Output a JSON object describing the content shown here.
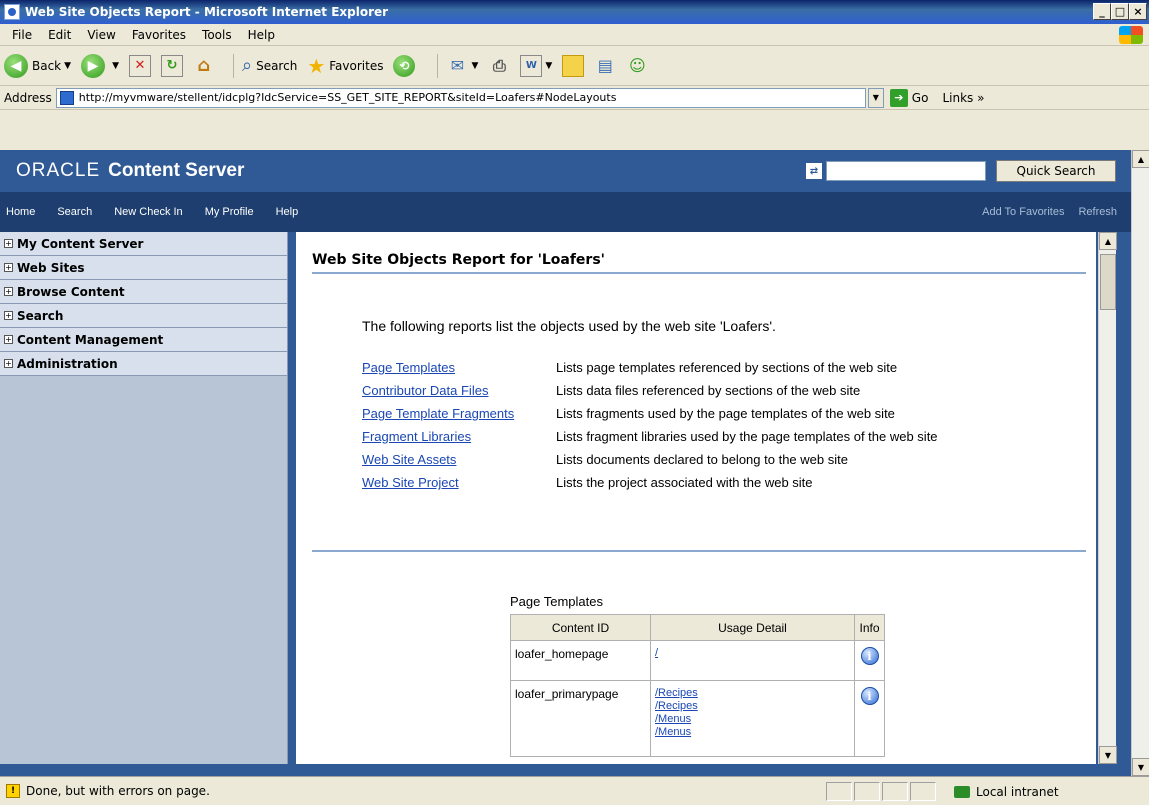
{
  "window": {
    "title": "Web Site Objects Report - Microsoft Internet Explorer"
  },
  "menu": [
    "File",
    "Edit",
    "View",
    "Favorites",
    "Tools",
    "Help"
  ],
  "toolbar": {
    "back_label": "Back",
    "search_label": "Search",
    "favorites_label": "Favorites"
  },
  "address": {
    "label": "Address",
    "url": "http://myvmware/stellent/idcplg?IdcService=SS_GET_SITE_REPORT&siteId=Loafers#NodeLayouts",
    "go_label": "Go",
    "links_label": "Links"
  },
  "header": {
    "brand_oracle": "ORACLE",
    "brand_product": "Content Server",
    "quick_search_label": "Quick Search"
  },
  "nav": {
    "items": [
      "Home",
      "Search",
      "New Check In",
      "My Profile",
      "Help"
    ],
    "right_items": [
      "Add To Favorites",
      "Refresh"
    ]
  },
  "sidebar": {
    "items": [
      "My Content Server",
      "Web Sites",
      "Browse Content",
      "Search",
      "Content Management",
      "Administration"
    ]
  },
  "main": {
    "title": "Web Site Objects Report for 'Loafers'",
    "intro": "The following reports list the objects used by the web site 'Loafers'.",
    "reports": [
      {
        "link": "Page Templates",
        "desc": "Lists page templates referenced by sections of the web site"
      },
      {
        "link": "Contributor Data Files",
        "desc": "Lists data files referenced by sections of the web site"
      },
      {
        "link": "Page Template Fragments",
        "desc": "Lists fragments used by the page templates of the web site"
      },
      {
        "link": "Fragment Libraries",
        "desc": "Lists fragment libraries used by the page templates of the web site"
      },
      {
        "link": "Web Site Assets",
        "desc": "Lists documents declared to belong to the web site"
      },
      {
        "link": "Web Site Project",
        "desc": "Lists the project associated with the web site"
      }
    ],
    "table": {
      "caption": "Page Templates",
      "headers": [
        "Content ID",
        "Usage Detail",
        "Info"
      ],
      "rows": [
        {
          "content_id": "loafer_homepage",
          "usage": [
            "/"
          ]
        },
        {
          "content_id": "loafer_primarypage",
          "usage": [
            "/Recipes",
            "/Recipes",
            "/Menus",
            "/Menus"
          ]
        }
      ]
    }
  },
  "status": {
    "text": "Done, but with errors on page.",
    "zone": "Local intranet"
  },
  "colors": {
    "oracle_header": "#2f5a96",
    "nav_bar": "#1d3e6e",
    "sidebar": "#b7c5d7",
    "link": "#1a47b4"
  }
}
